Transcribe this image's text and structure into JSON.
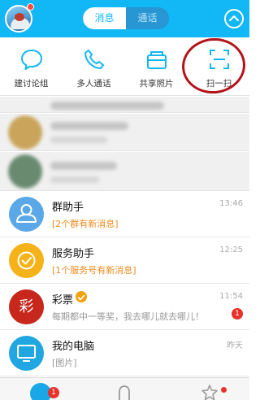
{
  "header": {
    "tab_messages": "消息",
    "tab_calls": "通话"
  },
  "quick_menu": [
    {
      "label": "建讨论组",
      "icon": "chat-bubble-icon"
    },
    {
      "label": "多人通话",
      "icon": "phone-icon"
    },
    {
      "label": "共享照片",
      "icon": "wallet-icon"
    },
    {
      "label": "扫一扫",
      "icon": "scan-icon"
    }
  ],
  "annotation_color": "#b3141a",
  "accent_color": "#12b7f5",
  "chats": [
    {
      "title": "群助手",
      "subtitle": "[2个群有新消息]",
      "time": "13:46"
    },
    {
      "title": "服务助手",
      "subtitle": "[1个服务号有新消息]",
      "time": "12:25"
    },
    {
      "title": "彩票",
      "subtitle": "每期都中一等奖，我去哪儿就去哪儿！",
      "time": "11:54",
      "unread": "1",
      "avatar_text": "彩"
    },
    {
      "title": "我的电脑",
      "subtitle": "[图片]",
      "time": "昨天"
    }
  ],
  "bottom_nav": {
    "messages_badge": "1"
  }
}
